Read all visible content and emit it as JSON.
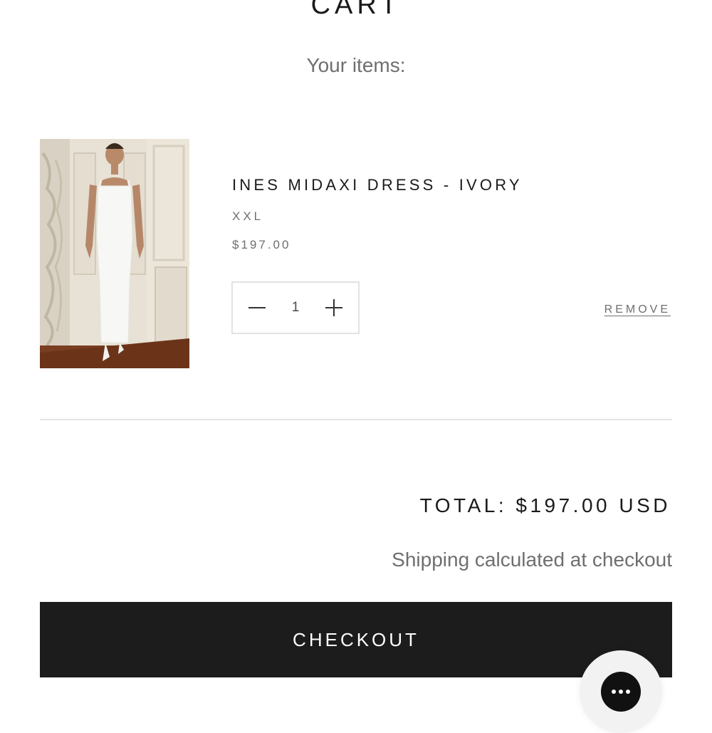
{
  "header": {
    "title": "CART",
    "subtitle": "Your items:"
  },
  "cart": {
    "items": [
      {
        "name": "INES MIDAXI DRESS - IVORY",
        "variant": "XXL",
        "price": "$197.00",
        "quantity": "1",
        "remove_label": "REMOVE",
        "image_icon": "product-photo"
      }
    ]
  },
  "summary": {
    "total": "TOTAL: $197.00 USD",
    "shipping_note": "Shipping calculated at checkout"
  },
  "actions": {
    "checkout_label": "CHECKOUT"
  },
  "icons": {
    "minus": "minus-icon",
    "plus": "plus-icon",
    "chat": "chat-ellipsis-icon"
  },
  "colors": {
    "text_primary": "#1a1a1a",
    "text_secondary": "#6f6f6f",
    "checkout_bg": "#1c1c1c",
    "divider": "#e4e4e4"
  }
}
